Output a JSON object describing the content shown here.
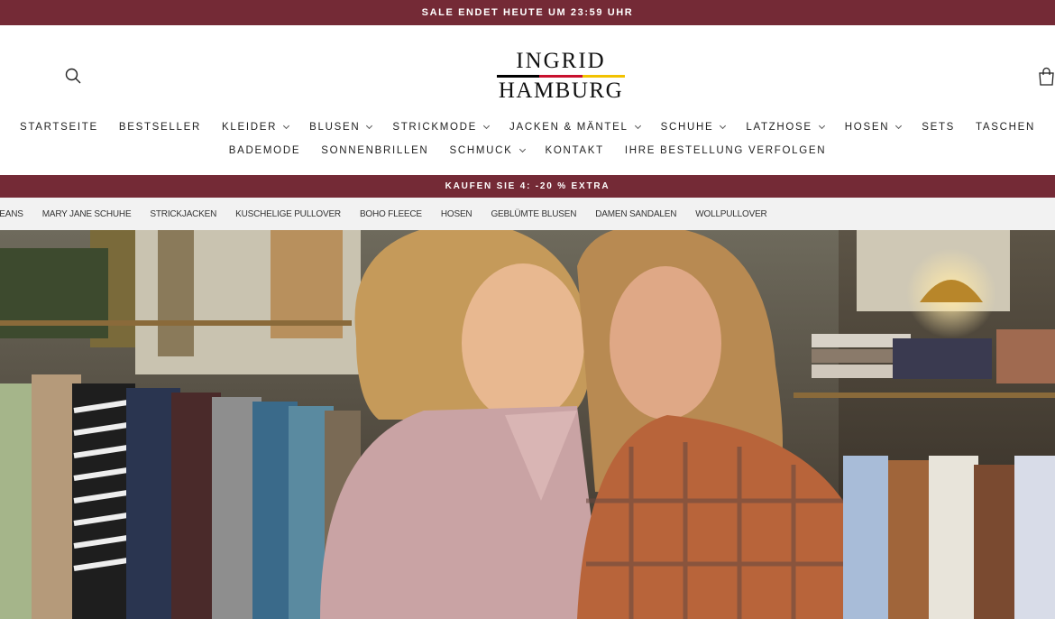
{
  "announcement": "SALE ENDET HEUTE UM 23:59 UHR",
  "logo": {
    "line1": "INGRID",
    "line2": "HAMBURG",
    "flag_colors": [
      "#000000",
      "#c8102e",
      "#f2c200"
    ]
  },
  "icons": {
    "search": "search-icon",
    "cart": "shopping-bag-icon",
    "dropdown": "chevron-down-icon"
  },
  "nav": {
    "row1": [
      {
        "label": "STARTSEITE",
        "dropdown": false
      },
      {
        "label": "BESTSELLER",
        "dropdown": false
      },
      {
        "label": "KLEIDER",
        "dropdown": true
      },
      {
        "label": "BLUSEN",
        "dropdown": true
      },
      {
        "label": "STRICKMODE",
        "dropdown": true
      },
      {
        "label": "JACKEN & MÄNTEL",
        "dropdown": true
      },
      {
        "label": "SCHUHE",
        "dropdown": true
      },
      {
        "label": "LATZHOSE",
        "dropdown": true
      },
      {
        "label": "HOSEN",
        "dropdown": true
      },
      {
        "label": "SETS",
        "dropdown": false
      },
      {
        "label": "TASCHEN",
        "dropdown": false
      }
    ],
    "row2": [
      {
        "label": "BADEMODE",
        "dropdown": false
      },
      {
        "label": "SONNENBRILLEN",
        "dropdown": false
      },
      {
        "label": "SCHMUCK",
        "dropdown": true
      },
      {
        "label": "KONTAKT",
        "dropdown": false
      },
      {
        "label": "IHRE BESTELLUNG VERFOLGEN",
        "dropdown": false
      }
    ]
  },
  "promo": "KAUFEN SIE 4: -20 % EXTRA",
  "chips": [
    "JEANS",
    "MARY JANE SCHUHE",
    "STRICKJACKEN",
    "KUSCHELIGE PULLOVER",
    "BOHO FLEECE",
    "HOSEN",
    "GEBLÜMTE BLUSEN",
    "DAMEN SANDALEN",
    "WOLLPULLOVER"
  ],
  "colors": {
    "brand": "#742a36",
    "chip_bar": "#f2f2f2"
  }
}
